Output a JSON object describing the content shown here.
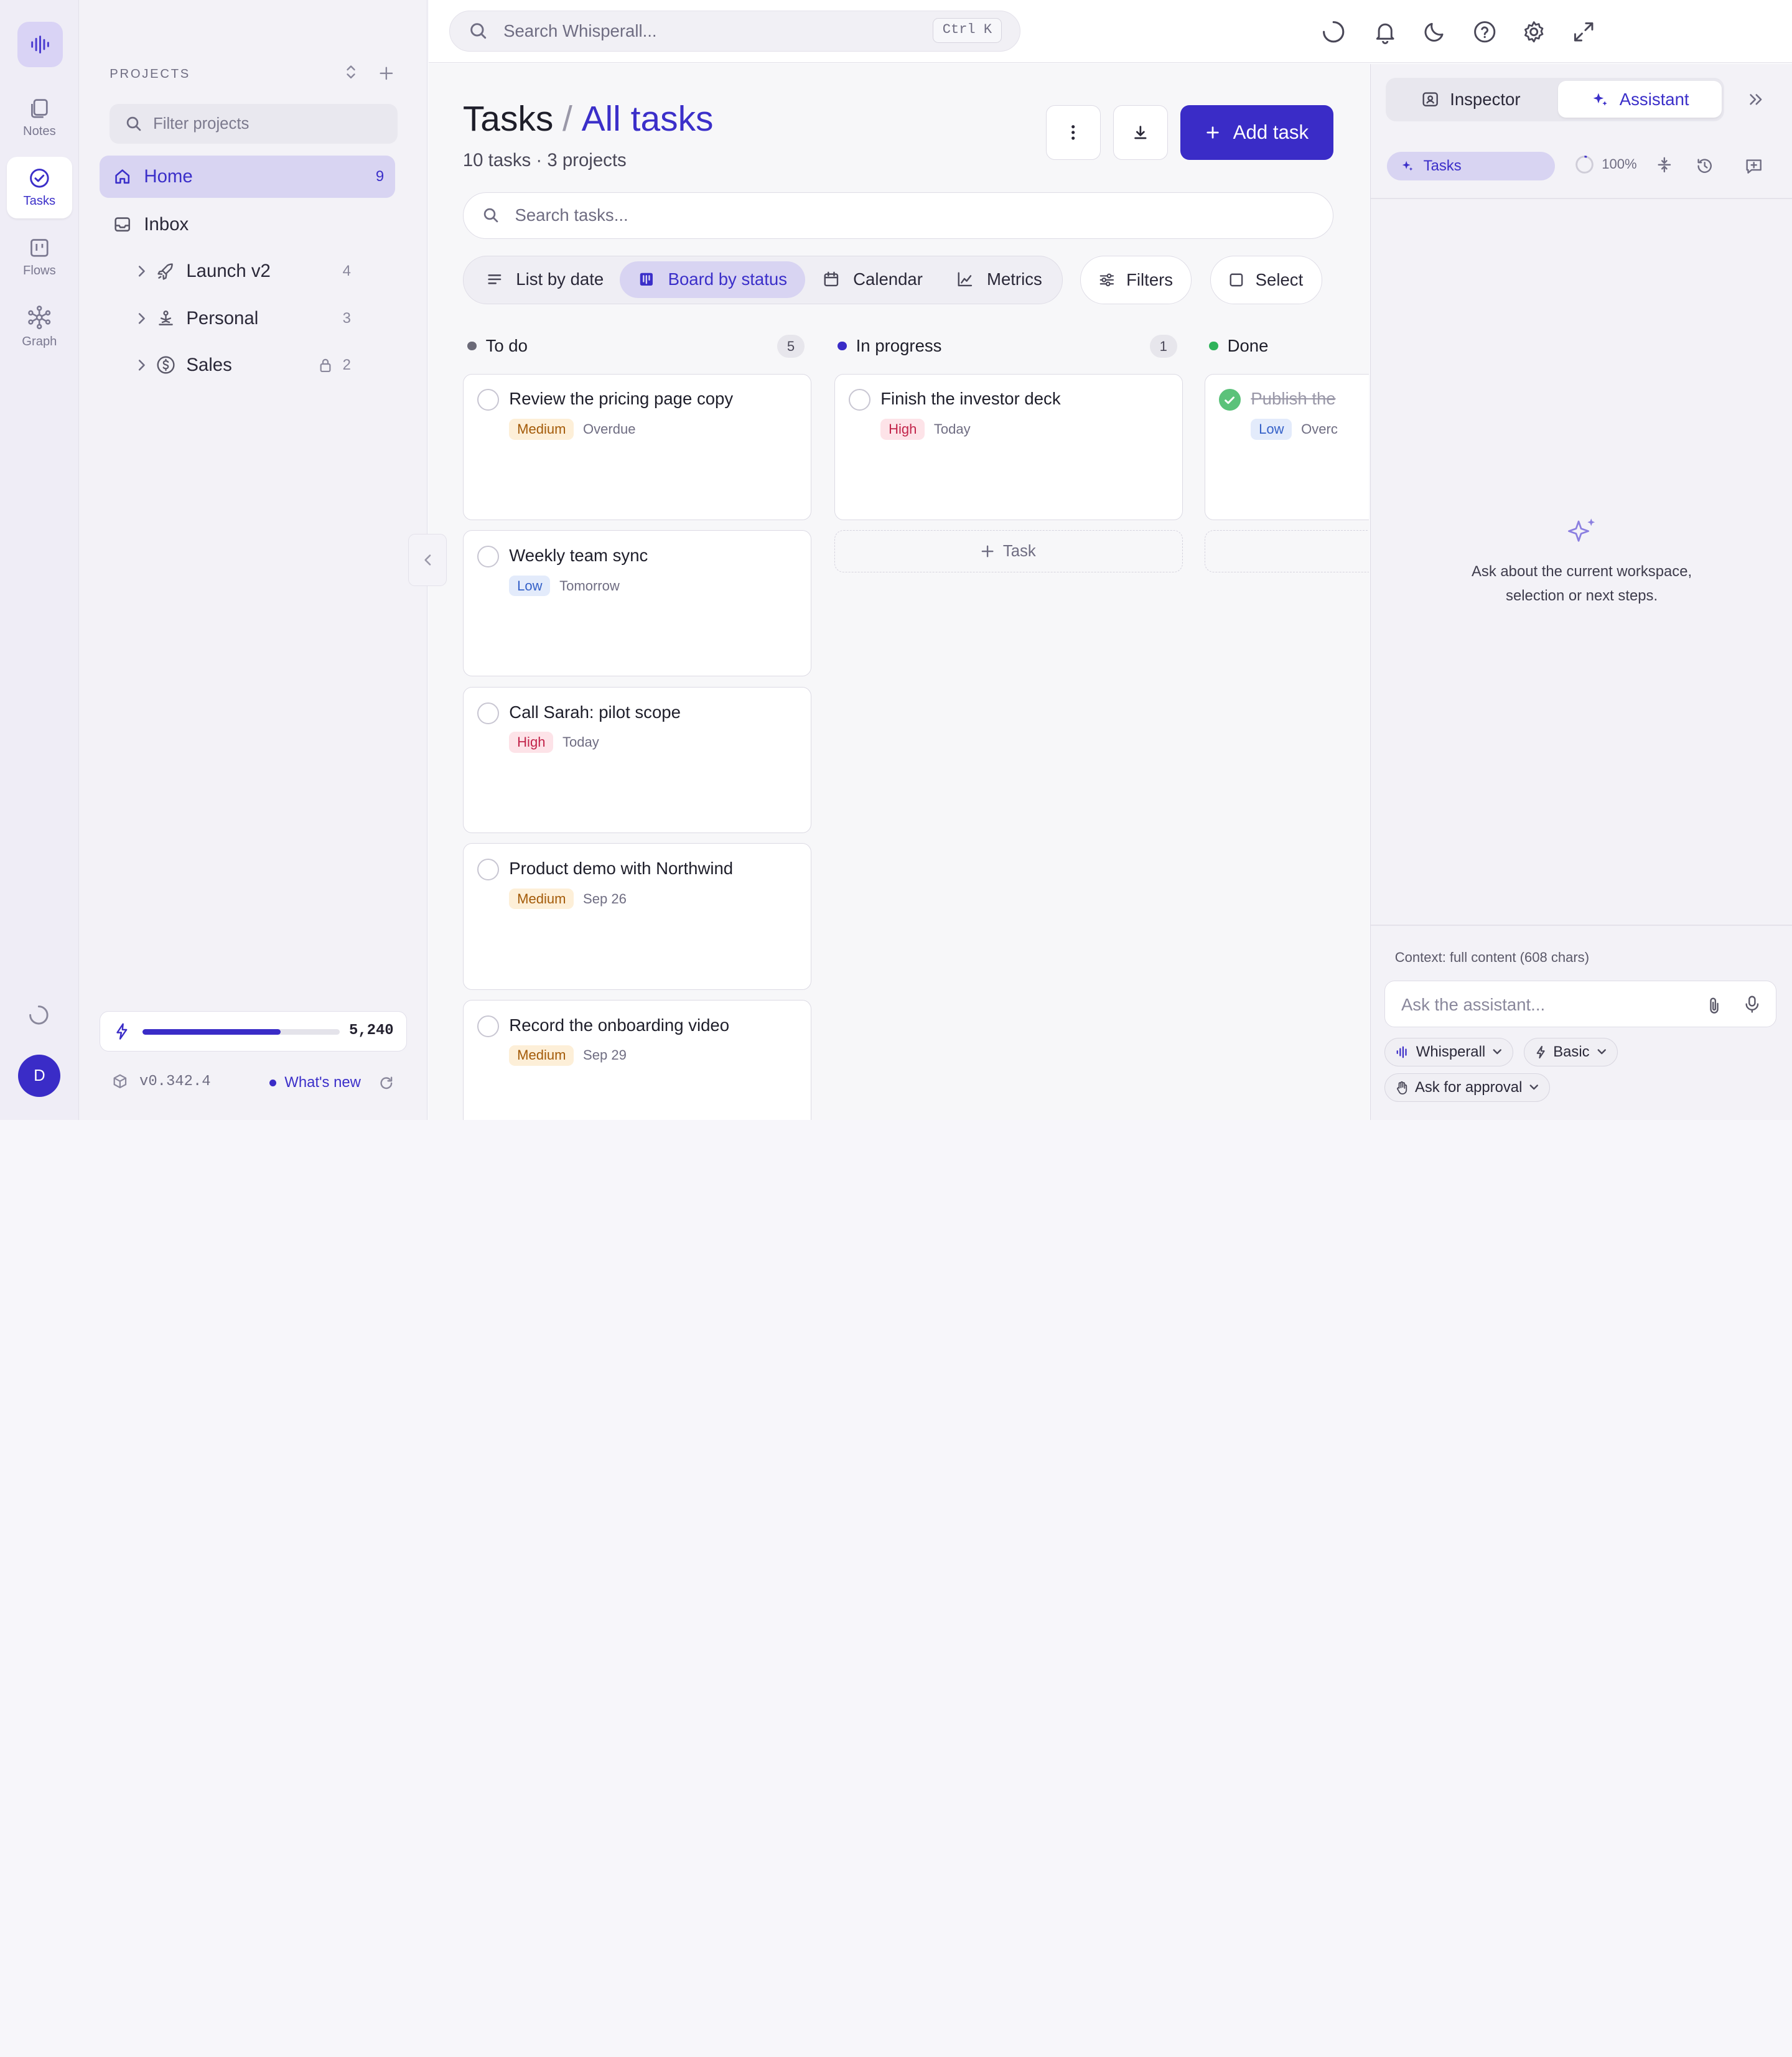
{
  "rail": {
    "items": [
      {
        "label": "Notes",
        "icon": "notes-icon"
      },
      {
        "label": "Tasks",
        "icon": "tasks-icon"
      },
      {
        "label": "Flows",
        "icon": "flows-icon"
      },
      {
        "label": "Graph",
        "icon": "graph-icon"
      }
    ],
    "avatar_initial": "D"
  },
  "sidebar": {
    "heading": "PROJECTS",
    "filter_placeholder": "Filter projects",
    "nav": [
      {
        "label": "Home",
        "count": "9"
      },
      {
        "label": "Inbox",
        "count": ""
      }
    ],
    "projects": [
      {
        "label": "Launch v2",
        "count": "4",
        "icon": "rocket-icon"
      },
      {
        "label": "Personal",
        "count": "3",
        "icon": "meditation-icon"
      },
      {
        "label": "Sales",
        "count": "2",
        "icon": "dollar-icon",
        "locked": true
      }
    ],
    "usage": {
      "value": "5,240",
      "fraction": 0.7
    },
    "version": "v0.342.4",
    "whats_new": "What's new"
  },
  "topbar": {
    "search_placeholder": "Search Whisperall...",
    "shortcut": "Ctrl K"
  },
  "main": {
    "title": "Tasks",
    "separator": "/",
    "breadcrumb": "All tasks",
    "subtitle": "10 tasks · 3 projects",
    "add_task_label": "Add task",
    "search_placeholder": "Search tasks...",
    "views": [
      {
        "label": "List by date",
        "icon": "list-icon"
      },
      {
        "label": "Board by status",
        "icon": "board-icon",
        "active": true
      },
      {
        "label": "Calendar",
        "icon": "calendar-icon"
      },
      {
        "label": "Metrics",
        "icon": "chart-icon"
      }
    ],
    "filters_label": "Filters",
    "select_label": "Select",
    "columns": [
      {
        "name": "To do",
        "count": "5",
        "color": "#6b6a78",
        "cards": [
          {
            "title": "Review the pricing page copy",
            "priority": "Medium",
            "due": "Overdue"
          },
          {
            "title": "Weekly team sync",
            "priority": "Low",
            "due": "Tomorrow"
          },
          {
            "title": "Call Sarah: pilot scope",
            "priority": "High",
            "due": "Today"
          },
          {
            "title": "Product demo with Northwind",
            "priority": "Medium",
            "due": "Sep 26"
          },
          {
            "title": "Record the onboarding video",
            "priority": "Medium",
            "due": "Sep 29"
          }
        ]
      },
      {
        "name": "In progress",
        "count": "1",
        "color": "#3a2cc7",
        "cards": [
          {
            "title": "Finish the investor deck",
            "priority": "High",
            "due": "Today"
          }
        ],
        "add_label": "Task"
      },
      {
        "name": "Done",
        "count": "",
        "color": "#2fb35a",
        "cards": [
          {
            "title": "Publish the",
            "priority": "Low",
            "due": "Overc",
            "done": true
          }
        ]
      }
    ]
  },
  "assistant": {
    "tabs": [
      "Inspector",
      "Assistant"
    ],
    "context_chip": "Tasks",
    "context_percent": "100%",
    "empty_text_line1": "Ask about the current workspace,",
    "empty_text_line2": "selection or next steps.",
    "context_note": "Context: full content (608 chars)",
    "input_placeholder": "Ask the assistant...",
    "model": "Whisperall",
    "mode": "Basic",
    "approval": "Ask for approval"
  }
}
